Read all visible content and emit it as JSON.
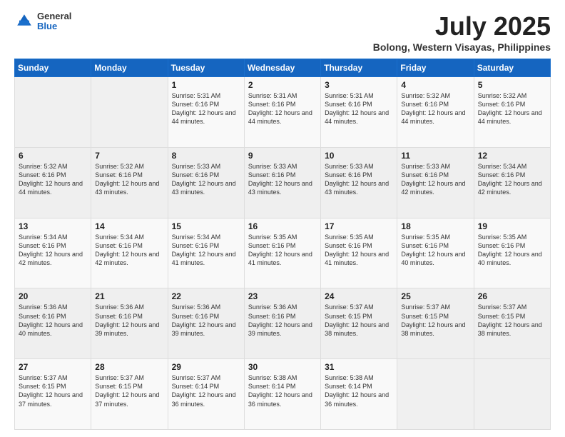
{
  "header": {
    "logo": {
      "line1": "General",
      "line2": "Blue"
    },
    "title": "July 2025",
    "subtitle": "Bolong, Western Visayas, Philippines"
  },
  "days_of_week": [
    "Sunday",
    "Monday",
    "Tuesday",
    "Wednesday",
    "Thursday",
    "Friday",
    "Saturday"
  ],
  "weeks": [
    [
      {
        "day": "",
        "sunrise": "",
        "sunset": "",
        "daylight": ""
      },
      {
        "day": "",
        "sunrise": "",
        "sunset": "",
        "daylight": ""
      },
      {
        "day": "1",
        "sunrise": "Sunrise: 5:31 AM",
        "sunset": "Sunset: 6:16 PM",
        "daylight": "Daylight: 12 hours and 44 minutes."
      },
      {
        "day": "2",
        "sunrise": "Sunrise: 5:31 AM",
        "sunset": "Sunset: 6:16 PM",
        "daylight": "Daylight: 12 hours and 44 minutes."
      },
      {
        "day": "3",
        "sunrise": "Sunrise: 5:31 AM",
        "sunset": "Sunset: 6:16 PM",
        "daylight": "Daylight: 12 hours and 44 minutes."
      },
      {
        "day": "4",
        "sunrise": "Sunrise: 5:32 AM",
        "sunset": "Sunset: 6:16 PM",
        "daylight": "Daylight: 12 hours and 44 minutes."
      },
      {
        "day": "5",
        "sunrise": "Sunrise: 5:32 AM",
        "sunset": "Sunset: 6:16 PM",
        "daylight": "Daylight: 12 hours and 44 minutes."
      }
    ],
    [
      {
        "day": "6",
        "sunrise": "Sunrise: 5:32 AM",
        "sunset": "Sunset: 6:16 PM",
        "daylight": "Daylight: 12 hours and 44 minutes."
      },
      {
        "day": "7",
        "sunrise": "Sunrise: 5:32 AM",
        "sunset": "Sunset: 6:16 PM",
        "daylight": "Daylight: 12 hours and 43 minutes."
      },
      {
        "day": "8",
        "sunrise": "Sunrise: 5:33 AM",
        "sunset": "Sunset: 6:16 PM",
        "daylight": "Daylight: 12 hours and 43 minutes."
      },
      {
        "day": "9",
        "sunrise": "Sunrise: 5:33 AM",
        "sunset": "Sunset: 6:16 PM",
        "daylight": "Daylight: 12 hours and 43 minutes."
      },
      {
        "day": "10",
        "sunrise": "Sunrise: 5:33 AM",
        "sunset": "Sunset: 6:16 PM",
        "daylight": "Daylight: 12 hours and 43 minutes."
      },
      {
        "day": "11",
        "sunrise": "Sunrise: 5:33 AM",
        "sunset": "Sunset: 6:16 PM",
        "daylight": "Daylight: 12 hours and 42 minutes."
      },
      {
        "day": "12",
        "sunrise": "Sunrise: 5:34 AM",
        "sunset": "Sunset: 6:16 PM",
        "daylight": "Daylight: 12 hours and 42 minutes."
      }
    ],
    [
      {
        "day": "13",
        "sunrise": "Sunrise: 5:34 AM",
        "sunset": "Sunset: 6:16 PM",
        "daylight": "Daylight: 12 hours and 42 minutes."
      },
      {
        "day": "14",
        "sunrise": "Sunrise: 5:34 AM",
        "sunset": "Sunset: 6:16 PM",
        "daylight": "Daylight: 12 hours and 42 minutes."
      },
      {
        "day": "15",
        "sunrise": "Sunrise: 5:34 AM",
        "sunset": "Sunset: 6:16 PM",
        "daylight": "Daylight: 12 hours and 41 minutes."
      },
      {
        "day": "16",
        "sunrise": "Sunrise: 5:35 AM",
        "sunset": "Sunset: 6:16 PM",
        "daylight": "Daylight: 12 hours and 41 minutes."
      },
      {
        "day": "17",
        "sunrise": "Sunrise: 5:35 AM",
        "sunset": "Sunset: 6:16 PM",
        "daylight": "Daylight: 12 hours and 41 minutes."
      },
      {
        "day": "18",
        "sunrise": "Sunrise: 5:35 AM",
        "sunset": "Sunset: 6:16 PM",
        "daylight": "Daylight: 12 hours and 40 minutes."
      },
      {
        "day": "19",
        "sunrise": "Sunrise: 5:35 AM",
        "sunset": "Sunset: 6:16 PM",
        "daylight": "Daylight: 12 hours and 40 minutes."
      }
    ],
    [
      {
        "day": "20",
        "sunrise": "Sunrise: 5:36 AM",
        "sunset": "Sunset: 6:16 PM",
        "daylight": "Daylight: 12 hours and 40 minutes."
      },
      {
        "day": "21",
        "sunrise": "Sunrise: 5:36 AM",
        "sunset": "Sunset: 6:16 PM",
        "daylight": "Daylight: 12 hours and 39 minutes."
      },
      {
        "day": "22",
        "sunrise": "Sunrise: 5:36 AM",
        "sunset": "Sunset: 6:16 PM",
        "daylight": "Daylight: 12 hours and 39 minutes."
      },
      {
        "day": "23",
        "sunrise": "Sunrise: 5:36 AM",
        "sunset": "Sunset: 6:16 PM",
        "daylight": "Daylight: 12 hours and 39 minutes."
      },
      {
        "day": "24",
        "sunrise": "Sunrise: 5:37 AM",
        "sunset": "Sunset: 6:15 PM",
        "daylight": "Daylight: 12 hours and 38 minutes."
      },
      {
        "day": "25",
        "sunrise": "Sunrise: 5:37 AM",
        "sunset": "Sunset: 6:15 PM",
        "daylight": "Daylight: 12 hours and 38 minutes."
      },
      {
        "day": "26",
        "sunrise": "Sunrise: 5:37 AM",
        "sunset": "Sunset: 6:15 PM",
        "daylight": "Daylight: 12 hours and 38 minutes."
      }
    ],
    [
      {
        "day": "27",
        "sunrise": "Sunrise: 5:37 AM",
        "sunset": "Sunset: 6:15 PM",
        "daylight": "Daylight: 12 hours and 37 minutes."
      },
      {
        "day": "28",
        "sunrise": "Sunrise: 5:37 AM",
        "sunset": "Sunset: 6:15 PM",
        "daylight": "Daylight: 12 hours and 37 minutes."
      },
      {
        "day": "29",
        "sunrise": "Sunrise: 5:37 AM",
        "sunset": "Sunset: 6:14 PM",
        "daylight": "Daylight: 12 hours and 36 minutes."
      },
      {
        "day": "30",
        "sunrise": "Sunrise: 5:38 AM",
        "sunset": "Sunset: 6:14 PM",
        "daylight": "Daylight: 12 hours and 36 minutes."
      },
      {
        "day": "31",
        "sunrise": "Sunrise: 5:38 AM",
        "sunset": "Sunset: 6:14 PM",
        "daylight": "Daylight: 12 hours and 36 minutes."
      },
      {
        "day": "",
        "sunrise": "",
        "sunset": "",
        "daylight": ""
      },
      {
        "day": "",
        "sunrise": "",
        "sunset": "",
        "daylight": ""
      }
    ]
  ]
}
